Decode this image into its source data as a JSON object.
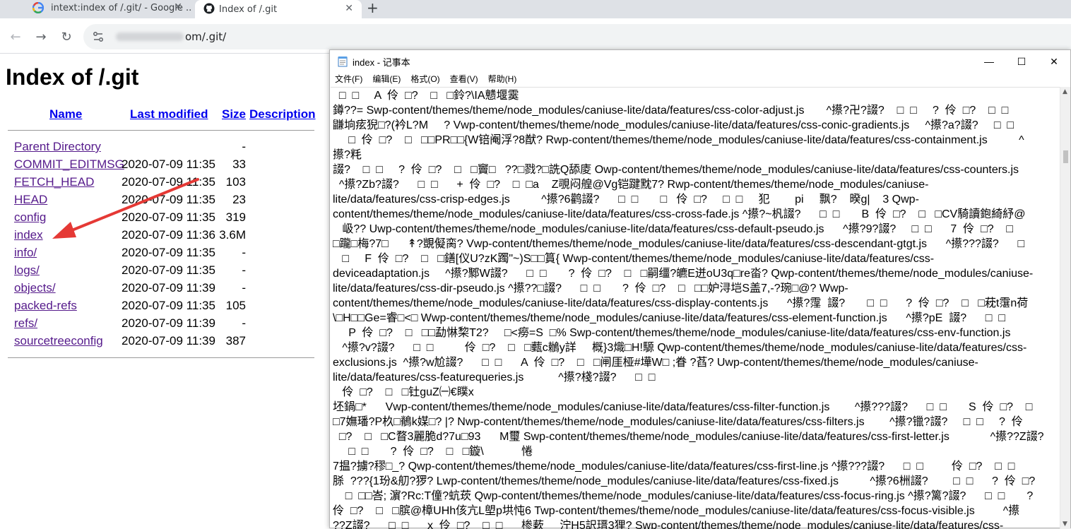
{
  "browser": {
    "tabs": [
      {
        "title": "intext:index of /.git/ - Google ...",
        "active": false,
        "icon": "google-icon"
      },
      {
        "title": "Index of /.git",
        "active": true,
        "icon": "github-icon"
      }
    ],
    "newtab_label": "+",
    "url_prefix": "",
    "url_suffix": "om/.git/"
  },
  "page": {
    "heading": "Index of /.git",
    "columns": {
      "name": "Name",
      "modified": "Last modified",
      "size": "Size",
      "description": "Description"
    },
    "rows": [
      {
        "name": "Parent Directory",
        "date": "",
        "size": "-"
      },
      {
        "name": "COMMIT_EDITMSG",
        "date": "2020-07-09 11:35",
        "size": "33"
      },
      {
        "name": "FETCH_HEAD",
        "date": "2020-07-09 11:35",
        "size": "103"
      },
      {
        "name": "HEAD",
        "date": "2020-07-09 11:35",
        "size": "23"
      },
      {
        "name": "config",
        "date": "2020-07-09 11:35",
        "size": "319"
      },
      {
        "name": "index",
        "date": "2020-07-09 11:36",
        "size": "3.6M"
      },
      {
        "name": "info/",
        "date": "2020-07-09 11:35",
        "size": "-"
      },
      {
        "name": "logs/",
        "date": "2020-07-09 11:35",
        "size": "-"
      },
      {
        "name": "objects/",
        "date": "2020-07-09 11:39",
        "size": "-"
      },
      {
        "name": "packed-refs",
        "date": "2020-07-09 11:35",
        "size": "105"
      },
      {
        "name": "refs/",
        "date": "2020-07-09 11:39",
        "size": "-"
      },
      {
        "name": "sourcetreeconfig",
        "date": "2020-07-09 11:39",
        "size": "387"
      }
    ]
  },
  "notepad": {
    "title": "index - 记事本",
    "controls": {
      "minimize": "—",
      "maximize": "☐",
      "close": "✕"
    },
    "menu": [
      "文件(F)",
      "编辑(E)",
      "格式(O)",
      "查看(V)",
      "帮助(H)"
    ],
    "lines": [
      "  □  □     A  伶  □?    □   □鈴?\\IA戆堰霙",
      "鐏??= Swp-content/themes/theme/node_modules/caniuse-lite/data/features/css-color-adjust.js       ^攃?卍?諁?    □  □     ?  伶  □?    □  □",
      "鼸垧痃猊□?(衿L?M     ? Vwp-content/themes/theme/node_modules/caniuse-lite/data/features/css-conic-gradients.js     ^攃?a?諁?     □  □",
      "     □  伶  □?    □   □□PR□□{W锫阉浮?8猷? Rwp-content/themes/theme/node_modules/caniuse-lite/data/features/css-containment.js          ^",
      "攃?粍",
      "諁?    □  □     ?  伶  □?    □   □竇□   ??□戮?□詵Q舔庱 Owp-content/themes/theme/node_modules/caniuse-lite/data/features/css-counters.js",
      "  ^攃?Zb?諁?      □  □      +  伶  □?    □  □a    Z覗闷艎@Vg铠踺黕7? Rwp-content/themes/theme/node_modules/caniuse-",
      "lite/data/features/css-crisp-edges.js          ^攃?6鹳諁?      □  □       □   伶  □?     □  □     犯        pi     飘?    暌g|    3 Qwp-",
      "content/themes/theme/node_modules/caniuse-lite/data/features/css-cross-fade.js ^攃?~杋諁?      □  □       B  伶  □?    □   □CV騎讀鉋綺紓@",
      "   岋?? Uwp-content/themes/theme/node_modules/caniuse-lite/data/features/css-default-pseudo.js      ^攃?9?諁?     □  □      7  伶  □?    □",
      "□躘□梅?7□      ↟?覬儗脔? Vwp-content/themes/theme/node_modules/caniuse-lite/data/features/css-descendant-gtgt.js      ^攃???諁?      □",
      "   □     F  伶  □?    □   □鐥[仪U?zK躅\"~)S□□篔{ Wwp-content/themes/theme/node_modules/caniuse-lite/data/features/css-",
      "deviceadaptation.js     ^攃?鄹W諁?      □  □       ?  伶  □?    □   □嗣缰?皫E迸oU3q□re畓? Qwp-content/themes/theme/node_modules/caniuse-",
      "lite/data/features/css-dir-pseudo.js ^攃??□諁?      □  □       ?  伶  □?    □   □□妒浔垲S盖7,-?琬□@? Wwp-",
      "content/themes/theme/node_modules/caniuse-lite/data/features/css-display-contents.js      ^攃?霪  諁?       □  □      ?  伶  □?    □   □萙t霮n荷",
      "\\□H□□Ge=睿□<□ Wwp-content/themes/theme/node_modules/caniuse-lite/data/features/css-element-function.js      ^攃?pE  諁?      □  □",
      "     P  伶  □?    □   □□勐惏棃T2?     □<癆=S  □% Swp-content/themes/theme/node_modules/caniuse-lite/data/features/css-env-function.js",
      "   ^攃?v?諁?      □  □          伶  □?    □   □薽c鶒y詳     概}3熾□H!騵 Qwp-content/themes/theme/node_modules/caniuse-lite/data/features/css-",
      "exclusions.js  ^攃?w尬諁?      □  □      A  伶  □?    □   □闸厓桠#墷W□ ;眷 ?萏? Uwp-content/themes/theme/node_modules/caniuse-",
      "lite/data/features/css-featurequeries.js           ^攃?棧?諁?      □  □",
      "   伶  □?    □   □钍guZ㈠€瞨x",
      "坯鍋□*      Vwp-content/themes/theme/node_modules/caniuse-lite/data/features/css-filter-function.js        ^攃???諁?      □  □       S  伶  □?    □",
      "□7嫵璠?P杦□鶺k媒□? |? Nwp-content/themes/theme/node_modules/caniuse-lite/data/features/css-filters.js        ^攃?镴?諁?     □  □     ?  伶",
      "  □?    □   □C瞀3麗脆d?7u□93      M璽 Swp-content/themes/theme/node_modules/caniuse-lite/data/features/css-first-letter.js             ^攃??Z諁?",
      "     □  □       ?  伶  □?    □   □鏇\\            惓",
      "7揾?擄?穋□_? Qwp-content/themes/theme/node_modules/caniuse-lite/data/features/css-first-line.js ^攃???諁?      □  □         伶  □?    □  □",
      "脎  ???{1玢&舠?猡? Lwp-content/themes/theme/node_modules/caniuse-lite/data/features/css-fixed.js          ^攃?6栦諁?        □  □      ?  伶  □?",
      "    □  □□峇; 濵?Rc:T僮?蚢莰 Qwp-content/themes/theme/node_modules/caniuse-lite/data/features/css-focus-ring.js ^攃?篱?諁?      □  □       ?",
      "伶  □?    □   □膑@樟UHh侅亢L塱p垬忳6 Twp-content/themes/theme/node_modules/caniuse-lite/data/features/css-focus-visible.js         ^攃",
      "??Z諁?      □  □      x  伶  □?    □  □      椮蔌     泞H5訳瑨3狸? Swp-content/themes/theme/node_modules/caniuse-lite/data/features/css-"
    ]
  }
}
